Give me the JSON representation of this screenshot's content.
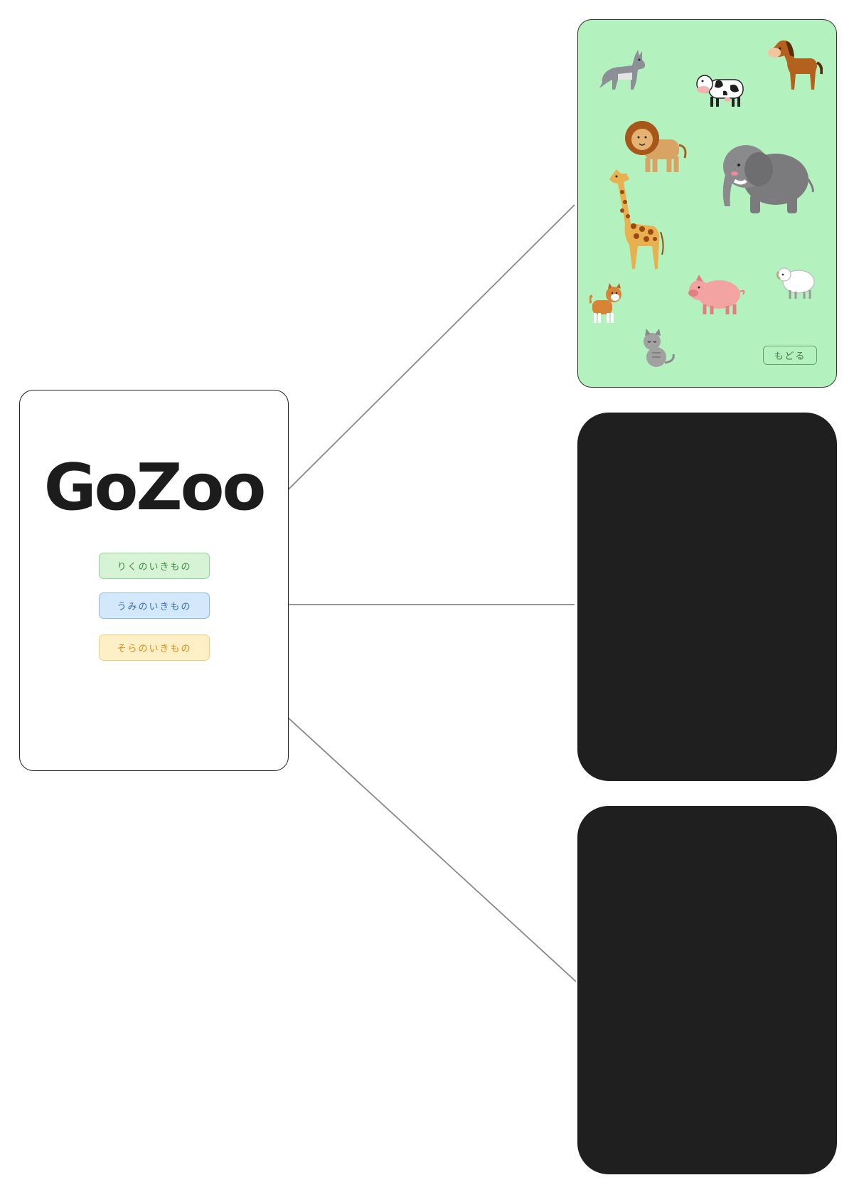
{
  "home": {
    "logo": "GoZoo",
    "buttons": [
      {
        "label": "りくのいきもの"
      },
      {
        "label": "うみのいきもの"
      },
      {
        "label": "そらのいきもの"
      }
    ]
  },
  "land_screen": {
    "animals": [
      "wolf-icon",
      "cow-icon",
      "horse-icon",
      "lion-icon",
      "elephant-icon",
      "giraffe-icon",
      "sheep-icon",
      "dog-icon",
      "pig-icon",
      "cat-icon"
    ],
    "back_label": "もどる"
  },
  "colors": {
    "land_bg": "#b3f2bf",
    "dark_screen": "#1f1f1f",
    "land_button": "#d6f4d5",
    "sea_button": "#d3e9fb",
    "sky_button": "#fdf0c6"
  }
}
